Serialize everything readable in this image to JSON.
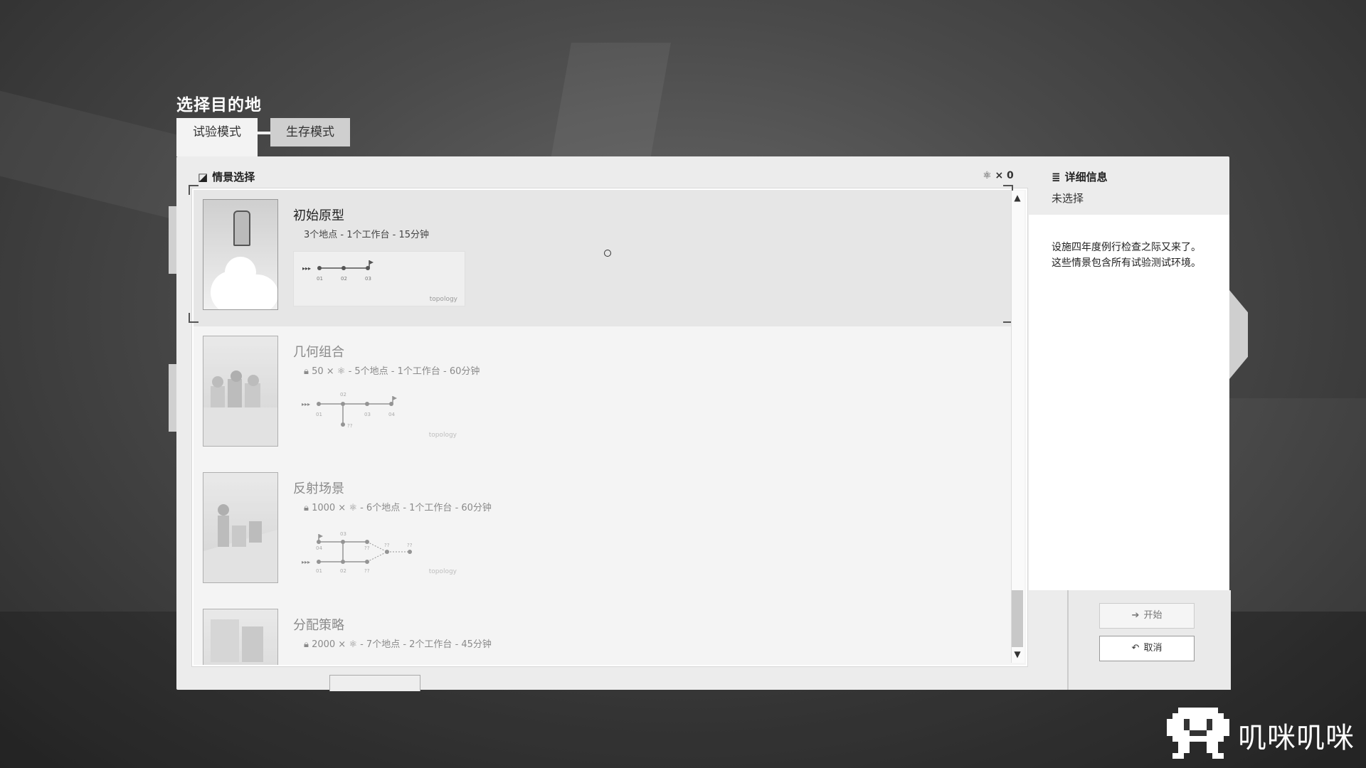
{
  "header": {
    "title": "选择目的地"
  },
  "tabs": [
    {
      "label": "试验模式",
      "active": true
    },
    {
      "label": "生存模式",
      "active": false
    }
  ],
  "scenario_panel": {
    "heading": "情景选择",
    "atom_count": "× 0",
    "items": [
      {
        "name": "初始原型",
        "meta": "3个地点 - 1个工作台 - 15分钟",
        "locked": false,
        "selected": true,
        "topology_label": "topology",
        "nodes": [
          "01",
          "02",
          "03"
        ]
      },
      {
        "name": "几何组合",
        "cost": "50 ×",
        "meta": "- 5个地点 - 1个工作台 - 60分钟",
        "locked": true,
        "topology_label": "topology",
        "nodes": [
          "01",
          "02",
          "03",
          "04",
          "??"
        ]
      },
      {
        "name": "反射场景",
        "cost": "1000 ×",
        "meta": "- 6个地点 - 1个工作台 - 60分钟",
        "locked": true,
        "topology_label": "topology",
        "nodes": [
          "01",
          "02",
          "03",
          "04",
          "??",
          "??",
          "??",
          "??"
        ]
      },
      {
        "name": "分配策略",
        "cost": "2000 ×",
        "meta": "- 7个地点 - 2个工作台 - 45分钟",
        "locked": true
      }
    ]
  },
  "details": {
    "heading": "详细信息",
    "selection": "未选择",
    "description_line1": "设施四年度例行检查之际又来了。",
    "description_line2": "这些情景包含所有试验测试环境。"
  },
  "buttons": {
    "start": "开始",
    "cancel": "取消"
  },
  "watermark": {
    "text": "叽咪叽咪"
  },
  "colors": {
    "panel": "#ececec",
    "selected_item": "#e6e6e6",
    "text_dark": "#222222",
    "text_locked": "#8a8a8a"
  }
}
